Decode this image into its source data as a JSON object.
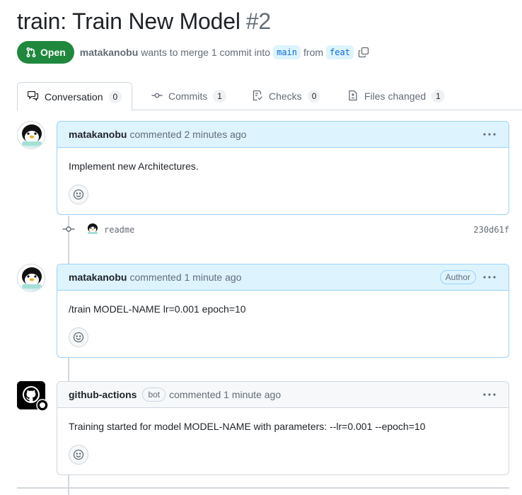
{
  "pr": {
    "title": "train: Train New Model",
    "number": "#2",
    "state": "Open",
    "author": "matakanobu",
    "merge_text": "wants to merge 1 commit into",
    "base_branch": "main",
    "from_text": "from",
    "head_branch": "feat"
  },
  "tabs": [
    {
      "label": "Conversation",
      "count": "0",
      "icon": "comment-discussion-icon",
      "active": true
    },
    {
      "label": "Commits",
      "count": "1",
      "icon": "git-commit-icon"
    },
    {
      "label": "Checks",
      "count": "0",
      "icon": "checklist-icon"
    },
    {
      "label": "Files changed",
      "count": "1",
      "icon": "file-diff-icon"
    }
  ],
  "comments": [
    {
      "author": "matakanobu",
      "meta": "commented 2 minutes ago",
      "body": "Implement new Architectures.",
      "avatar": "penguin-avatar"
    },
    {
      "author": "matakanobu",
      "meta": "commented 1 minute ago",
      "badge": "Author",
      "body": "/train MODEL-NAME lr=0.001 epoch=10",
      "avatar": "penguin-avatar"
    },
    {
      "author": "github-actions",
      "bot_label": "bot",
      "meta": "commented 1 minute ago",
      "body": "Training started for model MODEL-NAME with parameters: --lr=0.001 --epoch=10",
      "avatar": "github-actions-avatar"
    }
  ],
  "commit": {
    "message": "readme",
    "sha": "230d61f"
  },
  "colors": {
    "open_green": "#1f883d",
    "link_blue": "#0969da",
    "header_blue": "#ddf4ff",
    "border": "#d0d7de"
  }
}
